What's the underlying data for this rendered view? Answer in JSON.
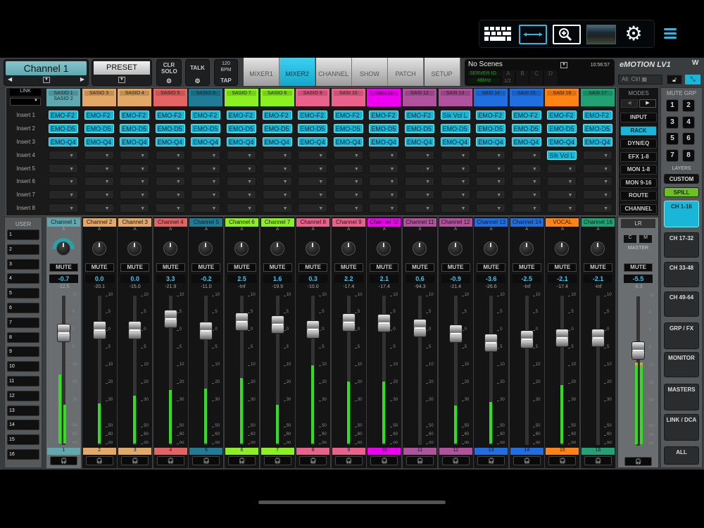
{
  "toolbar": {
    "icons": [
      "keyboard-icon",
      "fit-width-icon",
      "zoom-in-icon",
      "mixer-thumbnail-icon",
      "gear-icon",
      "menu-icon"
    ]
  },
  "header": {
    "channel_selector": "Channel 1",
    "preset": "PRESET",
    "clr_solo": "CLR SOLO",
    "talk": "TALK",
    "bpm": "120",
    "bpm_unit": "BPM",
    "tap": "TAP",
    "tabs": [
      {
        "label": "MIXER1"
      },
      {
        "label": "MIXER2",
        "active": true
      },
      {
        "label": "CHANNEL"
      },
      {
        "label": "SHOW"
      },
      {
        "label": "PATCH"
      },
      {
        "label": "SETUP"
      }
    ],
    "scenes": {
      "name": "No Scenes",
      "time": "10:56:57",
      "server": "SERVER IO",
      "rate": "48kHz",
      "slots": [
        "A",
        "B",
        "C",
        "D"
      ],
      "slot_a_value": "1/2"
    },
    "logo": "eMOTION LV1",
    "alt": "Alt",
    "ctrl": "Ctrl"
  },
  "insert_panel": {
    "link": "LINK",
    "row_labels": [
      "Insert 1",
      "Insert 2",
      "Insert 3",
      "Insert 4",
      "Insert 5",
      "Insert 6",
      "Insert 7",
      "Insert 8"
    ]
  },
  "modes": {
    "title": "MODES",
    "items": [
      {
        "label": "INPUT"
      },
      {
        "label": "RACK",
        "active": true
      },
      {
        "label": "DYN/EQ"
      },
      {
        "label": "EFX 1-8"
      },
      {
        "label": "MON 1-8"
      },
      {
        "label": "MON 9-16"
      },
      {
        "label": "ROUTE"
      },
      {
        "label": "CHANNEL"
      }
    ]
  },
  "mute_groups": {
    "title": "MUTE GRP",
    "items": [
      "1",
      "2",
      "3",
      "4",
      "5",
      "6",
      "7",
      "8"
    ]
  },
  "layers": {
    "title": "LAYERS",
    "custom": "CUSTOM",
    "spill": "SPILL",
    "items": [
      {
        "label": "CH 1-16",
        "active": true
      },
      {
        "label": "CH 17-32"
      },
      {
        "label": "CH 33-48"
      },
      {
        "label": "CH 49-64"
      },
      {
        "label": "GRP / FX"
      },
      {
        "label": "MONITOR"
      },
      {
        "label": "MASTERS"
      },
      {
        "label": "LINK / DCA"
      },
      {
        "label": "ALL"
      }
    ]
  },
  "user": {
    "title": "USER",
    "items": [
      "1",
      "2",
      "3",
      "4",
      "5",
      "6",
      "7",
      "8",
      "9",
      "10",
      "11",
      "12",
      "13",
      "14",
      "15",
      "16"
    ]
  },
  "scale": [
    "10",
    "5",
    "0",
    "5",
    "10",
    "20",
    "30",
    "50",
    "60",
    "oo"
  ],
  "channels": [
    {
      "name": "Channel 1",
      "source": "SASIO 1",
      "source2": "SASIO 2",
      "color": "#5fa8b0",
      "inserts": [
        "EMO-F2",
        "EMO-D5",
        "EMO-Q4"
      ],
      "mute": "MUTE",
      "gain": "-0.7",
      "peak": "-12.5",
      "fader_db": -0.7,
      "meter_db": [
        -15,
        -33
      ],
      "selected": true,
      "number": "1"
    },
    {
      "name": "Channel 2",
      "source": "SASIO 3",
      "color": "#e2a868",
      "inserts": [
        "EMO-F2",
        "EMO-D5",
        "EMO-Q4"
      ],
      "mute": "MUTE",
      "gain": "0.0",
      "peak": "-20.1",
      "fader_db": 0,
      "meter_db": [
        -32
      ],
      "number": "2"
    },
    {
      "name": "Channel 3",
      "source": "SASIO 4",
      "color": "#e2a868",
      "inserts": [
        "EMO-F2",
        "EMO-D5",
        "EMO-Q4"
      ],
      "mute": "MUTE",
      "gain": "0.0",
      "peak": "-15.0",
      "fader_db": 0,
      "meter_db": [
        -27
      ],
      "number": "3"
    },
    {
      "name": "Channel 4",
      "source": "SASIO 5",
      "color": "#e46464",
      "inserts": [
        "EMO-F2",
        "EMO-D5",
        "EMO-Q4"
      ],
      "mute": "MUTE",
      "gain": "3.3",
      "peak": "-21.9",
      "fader_db": 3.3,
      "meter_db": [
        -24
      ],
      "number": "4"
    },
    {
      "name": "Channel 5",
      "source": "SASIO 6",
      "color": "#1f7b96",
      "inserts": [
        "EMO-F2",
        "EMO-D5",
        "EMO-Q4"
      ],
      "mute": "MUTE",
      "gain": "-0.2",
      "peak": "-11.0",
      "fader_db": -0.2,
      "meter_db": [
        -23
      ],
      "number": "5"
    },
    {
      "name": "Channel 6",
      "source": "SASIO 7",
      "color": "#8cf020",
      "inserts": [
        "EMO-F2",
        "EMO-D5",
        "EMO-Q4"
      ],
      "mute": "MUTE",
      "gain": "2.5",
      "peak": "-Inf",
      "fader_db": 2.5,
      "meter_db": [
        -17
      ],
      "number": "6"
    },
    {
      "name": "Channel 7",
      "source": "SASIO 8",
      "color": "#8cf020",
      "inserts": [
        "EMO-F2",
        "EMO-D5",
        "EMO-Q4"
      ],
      "mute": "MUTE",
      "gain": "1.6",
      "peak": "-19.9",
      "fader_db": 1.6,
      "meter_db": [
        -33
      ],
      "number": "7"
    },
    {
      "name": "Channel 8",
      "source": "SASIO 9",
      "color": "#e9628c",
      "inserts": [
        "EMO-F2",
        "EMO-D5",
        "EMO-Q4"
      ],
      "mute": "MUTE",
      "gain": "0.3",
      "peak": "-10.0",
      "fader_db": 0.3,
      "meter_db": [
        -10
      ],
      "number": "8"
    },
    {
      "name": "Channel 9",
      "source": "SASI 10",
      "color": "#e9628c",
      "inserts": [
        "EMO-F2",
        "EMO-D5",
        "EMO-Q4"
      ],
      "mute": "MUTE",
      "gain": "2.2",
      "peak": "-17.4",
      "fader_db": 2.2,
      "meter_db": [
        -19
      ],
      "number": "9"
    },
    {
      "name": "Channel 10",
      "source": "SASI 11",
      "color": "#f000f0",
      "inserts": [
        "EMO-F2",
        "EMO-D5",
        "EMO-Q4"
      ],
      "mute": "MUTE",
      "gain": "2.1",
      "peak": "-17.4",
      "fader_db": 2.1,
      "meter_db": [
        -19
      ],
      "number": "10"
    },
    {
      "name": "Channel 11",
      "source": "SASI 12",
      "color": "#b0529c",
      "inserts": [
        "EMO-F2",
        "EMO-D5",
        "EMO-Q4"
      ],
      "mute": "MUTE",
      "gain": "0.6",
      "peak": "-94.3",
      "fader_db": 0.6,
      "meter_db": [],
      "number": "11"
    },
    {
      "name": "Channel 12",
      "source": "SASI 13",
      "color": "#b0529c",
      "inserts": [
        "Slk Vcl L",
        "EMO-D5",
        "EMO-Q4"
      ],
      "mute": "MUTE",
      "gain": "-0.9",
      "peak": "-21.4",
      "fader_db": -0.9,
      "meter_db": [
        -34
      ],
      "number": "12"
    },
    {
      "name": "Channel 13",
      "source": "SASI 14",
      "color": "#1f6fe0",
      "inserts": [
        "EMO-F2",
        "EMO-D5",
        "EMO-Q4"
      ],
      "mute": "MUTE",
      "gain": "-3.6",
      "peak": "-26.6",
      "fader_db": -3.6,
      "meter_db": [
        -31
      ],
      "number": "13"
    },
    {
      "name": "Channel 14",
      "source": "SASI 15",
      "color": "#1f6fe0",
      "inserts": [
        "EMO-F2",
        "EMO-D5",
        "EMO-Q4"
      ],
      "mute": "MUTE",
      "gain": "-2.5",
      "peak": "-Inf",
      "fader_db": -2.5,
      "meter_db": [],
      "number": "14"
    },
    {
      "name": "VOCAL",
      "source": "SASI 16",
      "color": "#ff8414",
      "inserts": [
        "EMO-F2",
        "EMO-D5",
        "EMO-Q4",
        "Slk Vcl L"
      ],
      "mute": "MUTE",
      "gain": "-2.1",
      "peak": "-17.4",
      "fader_db": -2.1,
      "meter_db": [
        -21
      ],
      "number": "15"
    },
    {
      "name": "Channel 16",
      "source": "SASI 17",
      "color": "#22a274",
      "inserts": [
        "EMO-F2",
        "EMO-D5",
        "EMO-Q4"
      ],
      "mute": "MUTE",
      "gain": "-2.1",
      "peak": "-Inf",
      "fader_db": -2.1,
      "meter_db": [],
      "number": "16"
    }
  ],
  "master": {
    "name": "LR",
    "c": "C",
    "m": "M",
    "label": "MASTER",
    "mute": "MUTE",
    "gain": "-5.5",
    "peak": "-6.3",
    "fader_db": -5.5,
    "meter_db": [
      -9,
      -9
    ]
  }
}
